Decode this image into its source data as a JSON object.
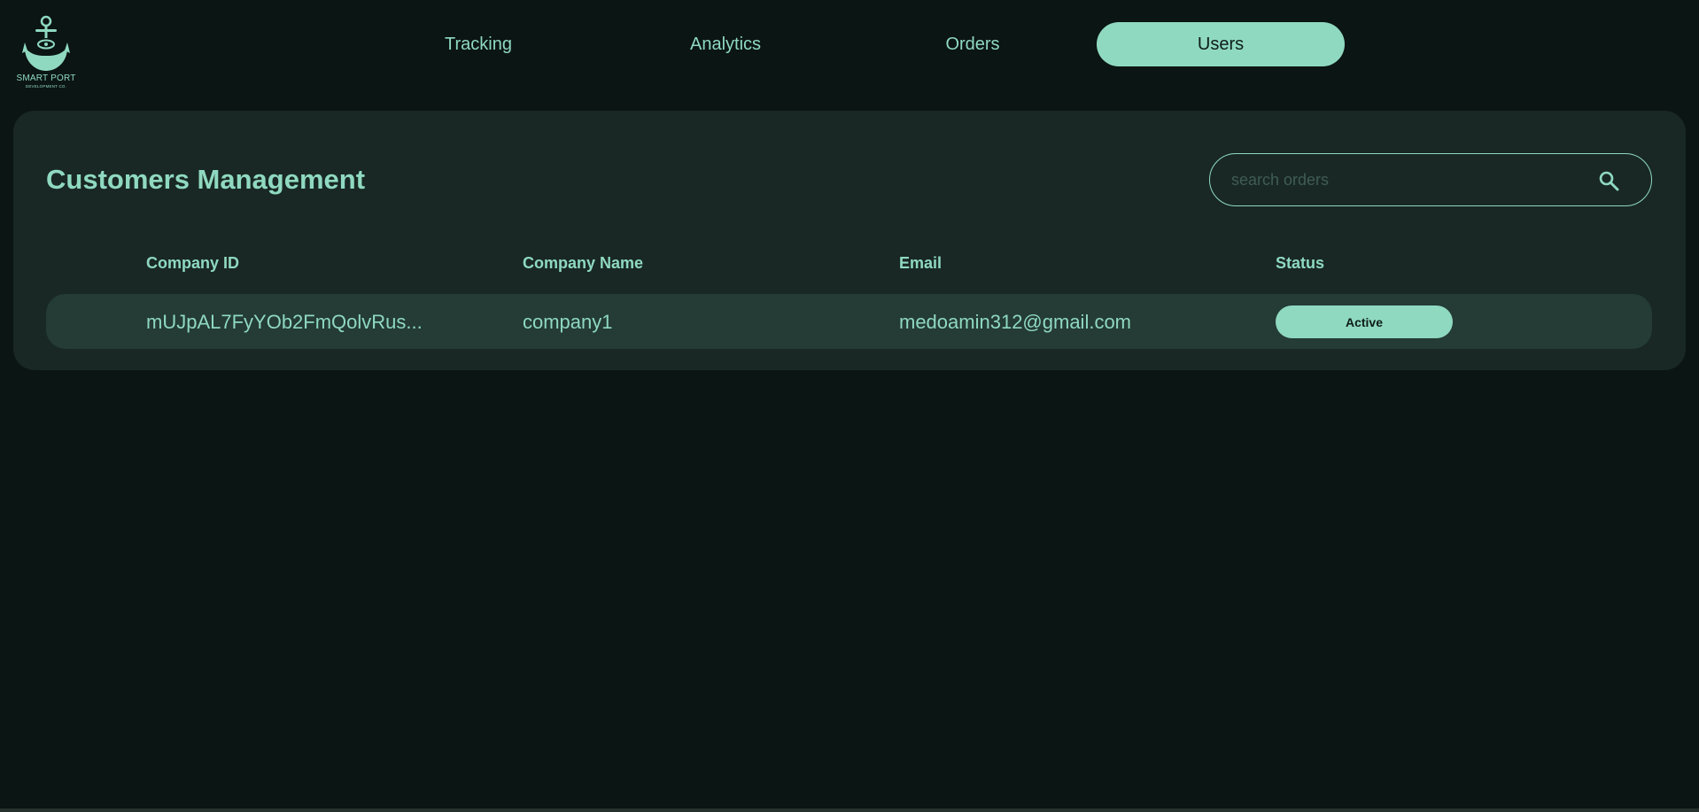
{
  "logo": {
    "brand": "SMART PORT",
    "subtitle": "DEVELOPMENT CO.",
    "icon": "anchor-icon"
  },
  "nav": {
    "items": [
      {
        "label": "Tracking"
      },
      {
        "label": "Analytics"
      },
      {
        "label": "Orders"
      },
      {
        "label": "Users",
        "active": true
      }
    ]
  },
  "page": {
    "title": "Customers Management"
  },
  "search": {
    "placeholder": "search orders",
    "value": "",
    "icon": "search-icon"
  },
  "table": {
    "columns": [
      "Company ID",
      "Company Name",
      "Email",
      "Status"
    ],
    "rows": [
      {
        "company_id": "mUJpAL7FyYOb2FmQolvRus...",
        "company_name": "company1",
        "email": "medoamin312@gmail.com",
        "status": "Active"
      }
    ]
  },
  "colors": {
    "background": "#0b1513",
    "panel": "#192824",
    "row": "#243b36",
    "accent": "#8fd9c0"
  }
}
